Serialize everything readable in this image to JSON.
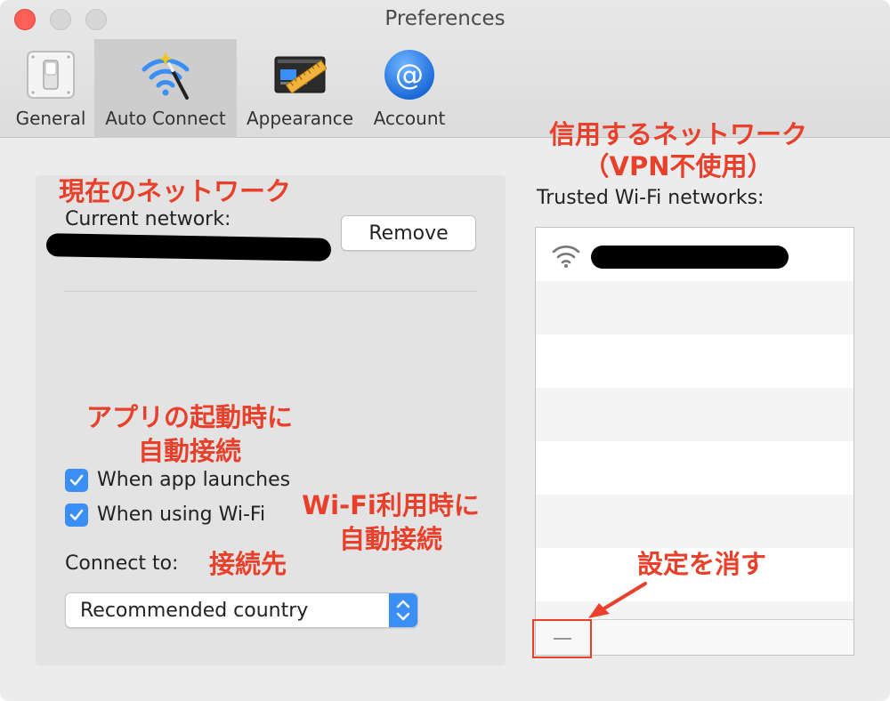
{
  "window": {
    "title": "Preferences"
  },
  "tabs": [
    {
      "label": "General",
      "icon": "switch-icon",
      "active": false
    },
    {
      "label": "Auto Connect",
      "icon": "wifi-wand-icon",
      "active": true
    },
    {
      "label": "Appearance",
      "icon": "ruler-screen-icon",
      "active": false
    },
    {
      "label": "Account",
      "icon": "at-sign-icon",
      "active": false
    }
  ],
  "current_network": {
    "label": "Current network:",
    "remove_label": "Remove"
  },
  "auto_connect": {
    "app_launch": {
      "label": "When app launches",
      "checked": true
    },
    "wifi": {
      "label": "When using Wi-Fi",
      "checked": true
    }
  },
  "connect_to": {
    "label": "Connect to:",
    "selected": "Recommended country"
  },
  "trusted": {
    "label": "Trusted Wi-Fi networks:"
  },
  "annotations": {
    "current_network": "現在のネットワーク",
    "trusted_line1": "信用するネットワーク",
    "trusted_line2": "（VPN不使用）",
    "app_launch_line1": "アプリの起動時に",
    "app_launch_line2": "自動接続",
    "wifi_line1": "Wi-Fi利用時に",
    "wifi_line2": "自動接続",
    "connect_to": "接続先",
    "delete_setting": "設定を消す"
  },
  "colors": {
    "accent": "#3a8ff6",
    "annotation": "#e8402a",
    "close": "#ff5f57"
  }
}
